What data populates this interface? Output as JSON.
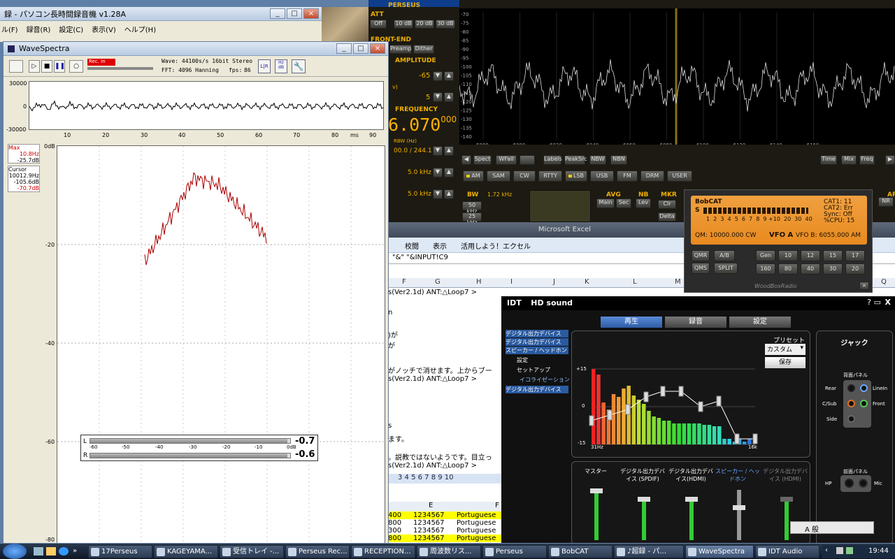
{
  "desktop": {
    "behind_title": "録 - パソコン長時間録音機 v1.28A",
    "behind_menu": [
      "ル(F)",
      "録音(R)",
      "設定(C)",
      "表示(V)",
      "ヘルプ(H)"
    ]
  },
  "perseus": {
    "app_name": "PERSEUS",
    "att": {
      "label": "ATT",
      "buttons": [
        "Off",
        "10 dB",
        "20 dB",
        "30 dB"
      ]
    },
    "frontend": {
      "label": "FRONT-END",
      "buttons": [
        "Preamp",
        "Dither"
      ]
    },
    "amplitude": {
      "label": "AMPLITUDE",
      "ref_value": "-65",
      "step_value": "5",
      "ref_unit": "v)"
    },
    "frequency": {
      "label": "FREQUENCY",
      "value": "6.070",
      "sub": "000"
    },
    "rbw": {
      "label": "RBW (Hz)",
      "value": "00.0 / 244.1"
    },
    "bw1": "5.0 kHz",
    "bw2": "5.0 kHz",
    "spectrum": {
      "y_ticks": [
        "-70",
        "-75",
        "-80",
        "-85",
        "-90",
        "-95",
        "-100",
        "-105",
        "-110",
        "-115",
        "-120",
        "-125",
        "-130",
        "-135",
        "-140"
      ],
      "x_ticks": [
        "5980",
        "6000",
        "6020",
        "6040",
        "6060",
        "6080",
        "6100",
        "6120",
        "6140",
        "6160"
      ]
    },
    "display_buttons": [
      "Spect",
      "WFall",
      "Labels",
      "PeakSrc",
      "NBW",
      "NBN"
    ],
    "right_buttons": [
      "Time",
      "Mix",
      "Freq"
    ],
    "modes": [
      "AM",
      "SAM",
      "CW",
      "RTTY",
      "LSB",
      "USB",
      "FM",
      "DRM",
      "USER"
    ],
    "active_mode": "LSB",
    "bw_panel": {
      "label": "BW",
      "value": "1.72 kHz",
      "buttons": [
        "50 kHz",
        "25 kHz"
      ]
    },
    "avg": {
      "label": "AVG",
      "main": "Main",
      "sec": "Sec"
    },
    "nb": {
      "label": "NB",
      "lev": "Lev"
    },
    "mkr": {
      "label": "MKR",
      "clr": "Clr",
      "delta": "Delta"
    },
    "af": "AF",
    "nr": "NR"
  },
  "excel": {
    "title": "Microsoft Excel",
    "ribbon_tabs": [
      "校閲",
      "表示",
      "活用しよう！エクセル"
    ],
    "formula": "\"&\" \"&INPUT!C9",
    "col_headers": [
      "F",
      "G",
      "H",
      "I",
      "J",
      "K",
      "L",
      "M",
      "Q"
    ],
    "rows": [
      "s(Ver2.1d)  ANT:△Loop7 >",
      "n",
      ")が",
      "が",
      "がノッチで消せます。上からブー",
      "s(Ver2.1d)  ANT:△Loop7 >",
      "s",
      "ます。",
      "。説教ではないようです。目立っ",
      "s(Ver2.1d)  ANT:△Loop7 >"
    ],
    "sheet_tabs": "3 4 5 6 7 8 9 10",
    "col_headers2": [
      "E",
      "F"
    ],
    "data_rows": [
      {
        "a": "400",
        "b": "1234567",
        "c": "Portuguese",
        "highlight": true
      },
      {
        "a": "800",
        "b": "1234567",
        "c": "Portuguese",
        "highlight": false
      },
      {
        "a": "300",
        "b": "1234567",
        "c": "Portuguese",
        "highlight": false
      },
      {
        "a": "800",
        "b": "1234567",
        "c": "Portuguese",
        "highlight": true
      }
    ]
  },
  "wavespectra": {
    "title": "WaveSpectra",
    "rec_label": "Rec. In",
    "wave_info": "Wave: 44100s/s 16bit Stereo",
    "fft_info": "FFT: 4096 Hanning",
    "fps_label": "fps:",
    "fps_value": "86",
    "lr": "L|R",
    "db": "Hz dB",
    "wave_y": [
      "30000",
      "0",
      "-30000"
    ],
    "wave_x": [
      "10",
      "20",
      "30",
      "40",
      "50",
      "60",
      "70",
      "80",
      "90"
    ],
    "wave_x_unit": "ms",
    "max_label": "Max",
    "max_freq": "10.8Hz",
    "max_db": "-25.7dB",
    "cursor_label": "Cursor",
    "cursor_freq": "10012.9Hz",
    "cursor_db1": "-105.6dB",
    "cursor_db2": "-70.7dB",
    "spec_y": [
      "0dB",
      "-20",
      "-40",
      "-60",
      "-80"
    ],
    "meter_scale": [
      "-60",
      "-50",
      "-40",
      "-30",
      "-20",
      "-10",
      "0dB"
    ],
    "meter_l": "L",
    "meter_r": "R",
    "level_l": "-0.7",
    "level_r": "-0.6",
    "level_l_fraction": 0.985,
    "level_r_fraction": 0.987
  },
  "idt": {
    "brand": "IDT",
    "product": "HD sound",
    "tabs": [
      "再生",
      "録音",
      "設定"
    ],
    "devices": [
      "デジタル出力デバイス",
      "デジタル出力デバイス",
      "スピーカー / ヘッドホン",
      "設定",
      "セットアップ",
      "イコライゼーション ▷",
      "デジタル出力デバイス"
    ],
    "preset_label": "プリセット",
    "preset_value": "カスタム",
    "save": "保存",
    "eq_y": [
      "+15",
      "0",
      "-15"
    ],
    "eq_x_low": "31Hz",
    "eq_x_high": "16k",
    "mixer_labels": [
      "マスター",
      "デジタル出力デバイス (SPDIF)",
      "デジタル出力デバイス(HDMI)",
      "スピーカー / ヘッドホン",
      "デジタル出力デバイス (HDMI)"
    ],
    "jack_title": "ジャック",
    "rear_panel": "背面パネル",
    "front_panel": "前面パネル",
    "jacks": [
      "Rear",
      "LineIn",
      "C/Sub",
      "Front",
      "Side",
      "HP",
      "Mic"
    ]
  },
  "bobcat": {
    "title": "BobCAT",
    "cat1": "CAT1: 11",
    "cat2": "CAT2: Err",
    "sync": "Sync:  Off",
    "cpu": "%CPU: 15",
    "s_label": "S",
    "s_scale": "1  2  3  4  5  6  7  8  9 +10  20  30  40",
    "qm": "QM: 10000.000 CW",
    "vfo_a": "VFO A",
    "vfo_b": "VFO B: 6055.000 AM",
    "buttons_left": [
      "QMR",
      "A/B",
      "QMS",
      "SPLIT"
    ],
    "buttons_right": [
      "Gen",
      "10",
      "12",
      "15",
      "17",
      "160",
      "80",
      "40",
      "30",
      "20"
    ],
    "footer": "WoodBoxRadio"
  },
  "taskbar": {
    "tasks": [
      "17Perseus",
      "KAGEYAMA...",
      "受信トレイ -...",
      "Perseus Rec...",
      "RECEPTION...",
      "周波数リス...",
      "Perseus",
      "BobCAT",
      "♪超録 - パ...",
      "WaveSpectra",
      "IDT Audio"
    ],
    "active_task": "WaveSpectra",
    "clock": "19:44",
    "ime": "A 般"
  }
}
